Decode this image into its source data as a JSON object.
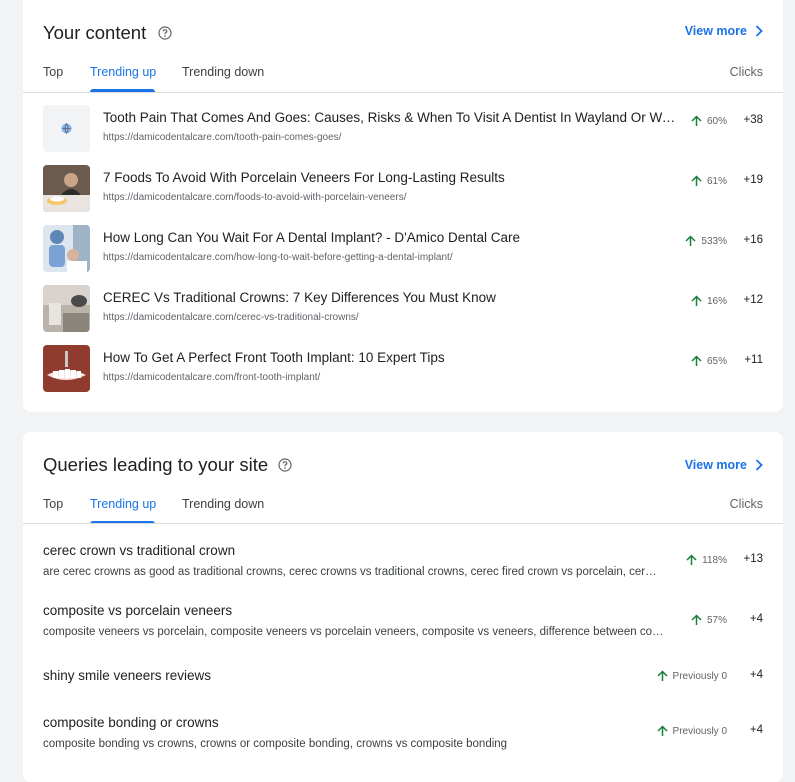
{
  "content_card": {
    "title": "Your content",
    "view_more": "View more",
    "tabs": [
      "Top",
      "Trending up",
      "Trending down"
    ],
    "metric_label": "Clicks",
    "rows": [
      {
        "title": "Tooth Pain That Comes And Goes: Causes, Risks & When To Visit A Dentist In Wayland Or Wat…",
        "url": "https://damicodentalcare.com/tooth-pain-comes-goes/",
        "change": "60%",
        "clicks": "+38",
        "thumb": "globe-placeholder-icon"
      },
      {
        "title": "7 Foods To Avoid With Porcelain Veneers For Long-Lasting Results",
        "url": "https://damicodentalcare.com/foods-to-avoid-with-porcelain-veneers/",
        "change": "61%",
        "clicks": "+19",
        "thumb": "photo"
      },
      {
        "title": "How Long Can You Wait For A Dental Implant? - D'Amico Dental Care",
        "url": "https://damicodentalcare.com/how-long-to-wait-before-getting-a-dental-implant/",
        "change": "533%",
        "clicks": "+16",
        "thumb": "photo"
      },
      {
        "title": "CEREC Vs Traditional Crowns: 7 Key Differences You Must Know",
        "url": "https://damicodentalcare.com/cerec-vs-traditional-crowns/",
        "change": "16%",
        "clicks": "+12",
        "thumb": "photo"
      },
      {
        "title": "How To Get A Perfect Front Tooth Implant: 10 Expert Tips",
        "url": "https://damicodentalcare.com/front-tooth-implant/",
        "change": "65%",
        "clicks": "+11",
        "thumb": "photo"
      }
    ]
  },
  "queries_card": {
    "title": "Queries leading to your site",
    "view_more": "View more",
    "tabs": [
      "Top",
      "Trending up",
      "Trending down"
    ],
    "metric_label": "Clicks",
    "rows": [
      {
        "title": "cerec crown vs traditional crown",
        "sub": "are cerec crowns as good as traditional crowns, cerec crowns vs traditional crowns, cerec fired crown vs porcelain, cer…",
        "change": "118%",
        "clicks": "+13"
      },
      {
        "title": "composite vs porcelain veneers",
        "sub": "composite veneers vs porcelain, composite veneers vs porcelain veneers, composite vs veneers, difference between co…",
        "change": "57%",
        "clicks": "+4"
      },
      {
        "title": "shiny smile veneers reviews",
        "sub": "",
        "change": "Previously 0",
        "clicks": "+4"
      },
      {
        "title": "composite bonding or crowns",
        "sub": "composite bonding vs crowns, crowns or composite bonding, crowns vs composite bonding",
        "change": "Previously 0",
        "clicks": "+4"
      }
    ]
  },
  "icons": {
    "help": "help-circle-icon",
    "chevron": "chevron-right-icon",
    "trend": "arrow-up-icon"
  },
  "colors": {
    "accent": "#1a73e8",
    "trend_up": "#188038",
    "background": "#f1f3f4",
    "card": "#ffffff"
  }
}
